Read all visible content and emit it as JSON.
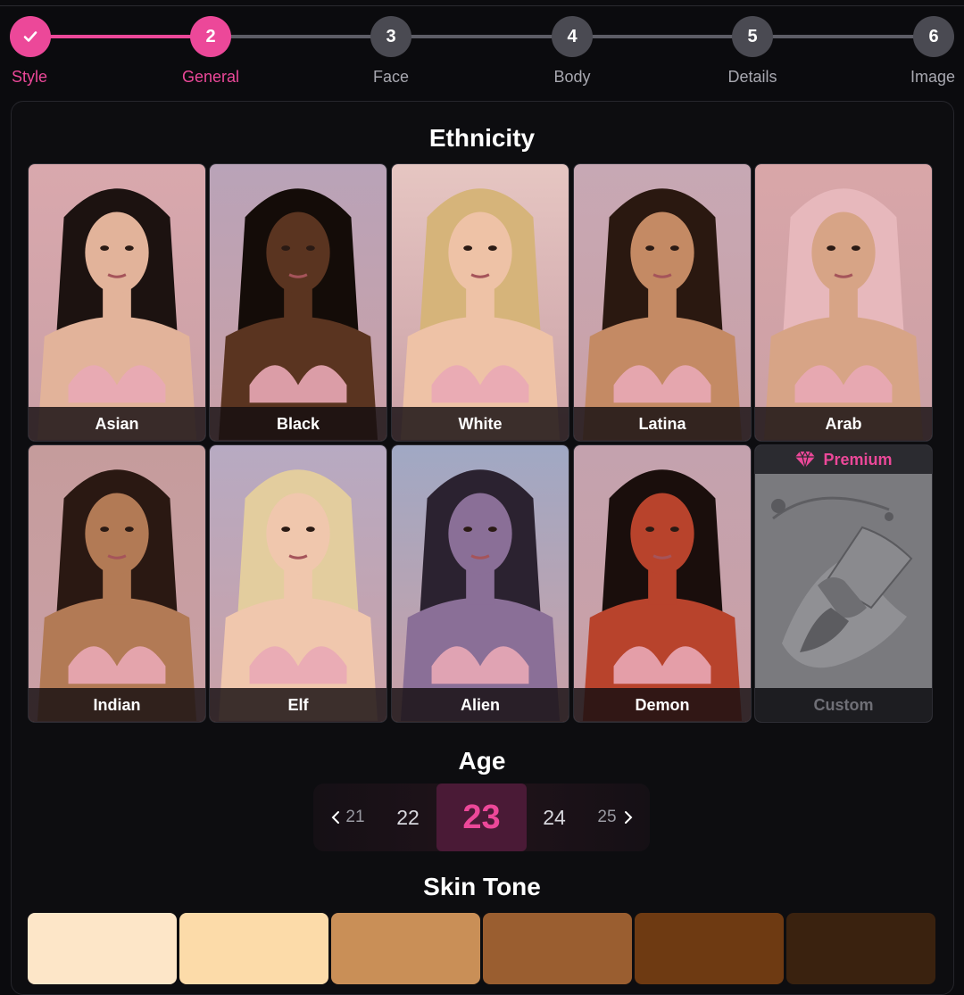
{
  "stepper": {
    "steps": [
      {
        "number": "1",
        "label": "Style",
        "state": "done"
      },
      {
        "number": "2",
        "label": "General",
        "state": "active"
      },
      {
        "number": "3",
        "label": "Face",
        "state": "todo"
      },
      {
        "number": "4",
        "label": "Body",
        "state": "todo"
      },
      {
        "number": "5",
        "label": "Details",
        "state": "todo"
      },
      {
        "number": "6",
        "label": "Image",
        "state": "todo"
      }
    ],
    "done_icon": "check-icon"
  },
  "ethnicity": {
    "title": "Ethnicity",
    "options": [
      {
        "label": "Asian",
        "skin": "#e2b39a",
        "hair": "#1c1210",
        "bg": "#d9a8ad"
      },
      {
        "label": "Black",
        "skin": "#5a3420",
        "hair": "#140c08",
        "bg": "#b9a3b8"
      },
      {
        "label": "White",
        "skin": "#eec2a6",
        "hair": "#d6b47a",
        "bg": "#e6c6c2"
      },
      {
        "label": "Latina",
        "skin": "#c48a64",
        "hair": "#2a1810",
        "bg": "#c7a8b4"
      },
      {
        "label": "Arab",
        "skin": "#d7a486",
        "hair": "#e7b8bc",
        "bg": "#d9a6a8"
      },
      {
        "label": "Indian",
        "skin": "#b27a55",
        "hair": "#2a1812",
        "bg": "#c59c9c"
      },
      {
        "label": "Elf",
        "skin": "#f0c7ad",
        "hair": "#e3cd9e",
        "bg": "#b7aac2"
      },
      {
        "label": "Alien",
        "skin": "#8a6f97",
        "hair": "#2b2230",
        "bg": "#a0a8c4"
      },
      {
        "label": "Demon",
        "skin": "#b8432c",
        "hair": "#1a0e0c",
        "bg": "#c4a2ae"
      }
    ],
    "custom": {
      "label": "Custom",
      "badge": "Premium",
      "badge_icon": "diamond-icon",
      "image_icon": "paintbrush-icon"
    }
  },
  "age": {
    "title": "Age",
    "values": [
      "21",
      "22",
      "23",
      "24",
      "25"
    ],
    "selected": "23",
    "prev_icon": "chevron-left-icon",
    "next_icon": "chevron-right-icon"
  },
  "skin_tone": {
    "title": "Skin Tone",
    "tones": [
      "#fde6c8",
      "#fcdba9",
      "#c98f57",
      "#9a5e30",
      "#6e3a12",
      "#3a220f"
    ]
  },
  "colors": {
    "accent": "#ec4899",
    "step_inactive": "#4a4a52"
  }
}
